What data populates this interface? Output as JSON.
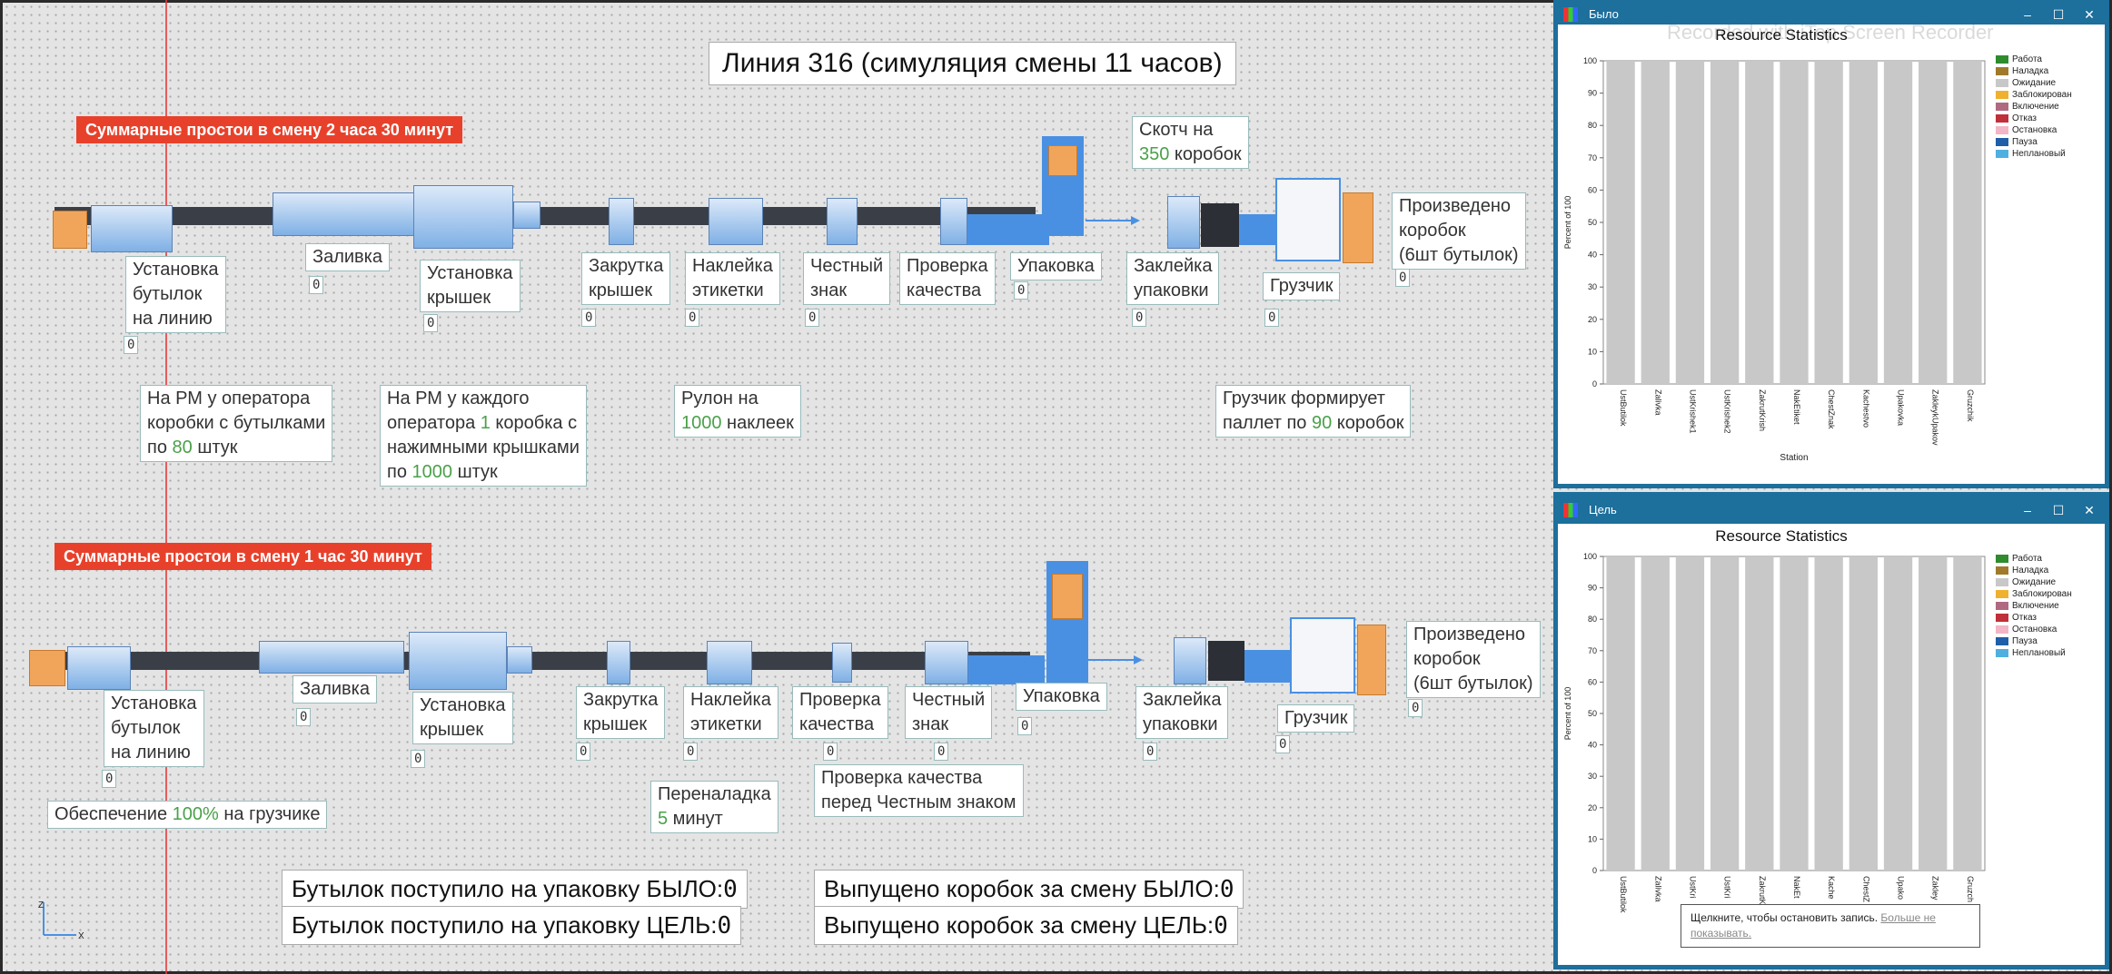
{
  "title": {
    "pre": "Линия ",
    "num": "316",
    "post": " (симуляция смены 11 часов)"
  },
  "line1": {
    "alert": {
      "pre": "Суммарные простои в смену ",
      "num1": "2",
      "mid": " часа ",
      "num2": "30",
      "post": " минут"
    },
    "stations": [
      "Установка\nбутылок\nна линию",
      "Заливка",
      "Установка\nкрышек",
      "Закрутка\nкрышек",
      "Наклейка\nэтикетки",
      "Честный\nзнак",
      "Проверка\nкачества",
      "Упаковка",
      "Заклейка\nупаковки",
      "Грузчик",
      "Произведено\nкоробок\n(6шт бутылок)"
    ],
    "counter": "0",
    "notes": {
      "tape": {
        "l1": "Скотч на",
        "num": "350",
        "post": " коробок"
      },
      "bottles": {
        "l1": "На РМ у оператора",
        "l2": "коробки с бутылками",
        "pre": "по ",
        "num": "80",
        "post": " штук"
      },
      "caps": {
        "l1": "На РМ у каждого",
        "pre2": "оператора ",
        "num1": "1",
        "post2": " коробка с",
        "l3": "нажимными крышками",
        "pre": "по ",
        "num": "1000",
        "post": " штук"
      },
      "roll": {
        "l1": "Рулон на",
        "num": "1000",
        "post": " наклеек"
      },
      "loader": {
        "l1": "Грузчик формирует",
        "pre": "паллет по ",
        "num": "90",
        "post": " коробок"
      }
    }
  },
  "line2": {
    "alert": {
      "pre": "Суммарные простои в смену ",
      "num1": "1",
      "mid": " час ",
      "num2": "30",
      "post": " минут"
    },
    "stations": [
      "Установка\nбутылок\nна линию",
      "Заливка",
      "Установка\nкрышек",
      "Закрутка\nкрышек",
      "Наклейка\nэтикетки",
      "Проверка\nкачества",
      "Честный\nзнак",
      "Упаковка",
      "Заклейка\nупаковки",
      "Грузчик",
      "Произведено\nкоробок\n(6шт бутылок)"
    ],
    "counter": "0",
    "notes": {
      "supply": {
        "pre": "Обеспечение ",
        "num": "100%",
        "post": " на грузчике"
      },
      "changeover": {
        "l1": "Переналадка",
        "num": "5",
        "post": " минут"
      },
      "qc": {
        "l1": "Проверка качества",
        "l2": "перед Честным знаком"
      }
    }
  },
  "summary": {
    "bottles_before": "Бутылок поступило на упаковку БЫЛО:",
    "bottles_target": "Бутылок поступило на упаковку ЦЕЛЬ:",
    "boxes_before": "Выпущено коробок за смену БЫЛО:",
    "boxes_target": "Выпущено коробок за смену ЦЕЛЬ:",
    "value": "0"
  },
  "window1": {
    "title": "Было",
    "watermark": "Recorded with iTop Screen Recorder",
    "chart_title": "Resource Statistics"
  },
  "window2": {
    "title": "Цель",
    "chart_title": "Resource Statistics"
  },
  "tooltip": {
    "text": "Щелкните, чтобы остановить запись.",
    "link": "Больше не показывать."
  },
  "colors": {
    "alert": "#e8412b",
    "accent": "#4a90e2",
    "window": "#1d6f9c"
  },
  "chart_data": [
    {
      "type": "bar",
      "title": "Resource Statistics",
      "xlabel": "Station",
      "ylabel": "Percent of 100",
      "ylim": [
        0,
        100
      ],
      "yticks": [
        0,
        10,
        20,
        30,
        40,
        50,
        60,
        70,
        80,
        90,
        100
      ],
      "categories": [
        "UstButilok",
        "Zalivka",
        "UstKrishek1",
        "UstKrishek2",
        "ZakrutKrish",
        "NakEtiket",
        "ChestZnak",
        "Kachestvo",
        "Upakovka",
        "ZakleykUpakov",
        "Gruzchik"
      ],
      "series": [
        {
          "name": "Работа",
          "color": "#2e8b2e",
          "values": [
            0,
            0,
            0,
            0,
            0,
            0,
            0,
            0,
            0,
            0,
            0
          ]
        },
        {
          "name": "Наладка",
          "color": "#a07a2a",
          "values": [
            0,
            0,
            0,
            0,
            0,
            0,
            0,
            0,
            0,
            0,
            0
          ]
        },
        {
          "name": "Ожидание",
          "color": "#c8c8c8",
          "values": [
            100,
            100,
            100,
            100,
            100,
            100,
            100,
            100,
            100,
            100,
            100
          ]
        },
        {
          "name": "Заблокирован",
          "color": "#f0b030",
          "values": [
            0,
            0,
            0,
            0,
            0,
            0,
            0,
            0,
            0,
            0,
            0
          ]
        },
        {
          "name": "Включение",
          "color": "#b06a80",
          "values": [
            0,
            0,
            0,
            0,
            0,
            0,
            0,
            0,
            0,
            0,
            0
          ]
        },
        {
          "name": "Отказ",
          "color": "#c0303a",
          "values": [
            0,
            0,
            0,
            0,
            0,
            0,
            0,
            0,
            0,
            0,
            0
          ]
        },
        {
          "name": "Остановка",
          "color": "#f2b6c6",
          "values": [
            0,
            0,
            0,
            0,
            0,
            0,
            0,
            0,
            0,
            0,
            0
          ]
        },
        {
          "name": "Пауза",
          "color": "#1f5fa8",
          "values": [
            0,
            0,
            0,
            0,
            0,
            0,
            0,
            0,
            0,
            0,
            0
          ]
        },
        {
          "name": "Неплановый",
          "color": "#4fb0e0",
          "values": [
            0,
            0,
            0,
            0,
            0,
            0,
            0,
            0,
            0,
            0,
            0
          ]
        }
      ]
    },
    {
      "type": "bar",
      "title": "Resource Statistics",
      "ylabel": "Percent of 100",
      "ylim": [
        0,
        100
      ],
      "yticks": [
        0,
        10,
        20,
        30,
        40,
        50,
        60,
        70,
        80,
        90,
        100
      ],
      "categories": [
        "UstButilok",
        "Zalivka",
        "UstKri",
        "UstKri",
        "ZakrutK",
        "NakEt",
        "Kache",
        "ChestZ",
        "Upako",
        "Zakley",
        "Gruzch"
      ],
      "series": [
        {
          "name": "Работа",
          "color": "#2e8b2e",
          "values": [
            0,
            0,
            0,
            0,
            0,
            0,
            0,
            0,
            0,
            0,
            0
          ]
        },
        {
          "name": "Наладка",
          "color": "#a07a2a",
          "values": [
            0,
            0,
            0,
            0,
            0,
            0,
            0,
            0,
            0,
            0,
            0
          ]
        },
        {
          "name": "Ожидание",
          "color": "#c8c8c8",
          "values": [
            100,
            100,
            100,
            100,
            100,
            100,
            100,
            100,
            100,
            100,
            100
          ]
        },
        {
          "name": "Заблокирован",
          "color": "#f0b030",
          "values": [
            0,
            0,
            0,
            0,
            0,
            0,
            0,
            0,
            0,
            0,
            0
          ]
        },
        {
          "name": "Включение",
          "color": "#b06a80",
          "values": [
            0,
            0,
            0,
            0,
            0,
            0,
            0,
            0,
            0,
            0,
            0
          ]
        },
        {
          "name": "Отказ",
          "color": "#c0303a",
          "values": [
            0,
            0,
            0,
            0,
            0,
            0,
            0,
            0,
            0,
            0,
            0
          ]
        },
        {
          "name": "Остановка",
          "color": "#f2b6c6",
          "values": [
            0,
            0,
            0,
            0,
            0,
            0,
            0,
            0,
            0,
            0,
            0
          ]
        },
        {
          "name": "Пауза",
          "color": "#1f5fa8",
          "values": [
            0,
            0,
            0,
            0,
            0,
            0,
            0,
            0,
            0,
            0,
            0
          ]
        },
        {
          "name": "Неплановый",
          "color": "#4fb0e0",
          "values": [
            0,
            0,
            0,
            0,
            0,
            0,
            0,
            0,
            0,
            0,
            0
          ]
        }
      ]
    }
  ]
}
